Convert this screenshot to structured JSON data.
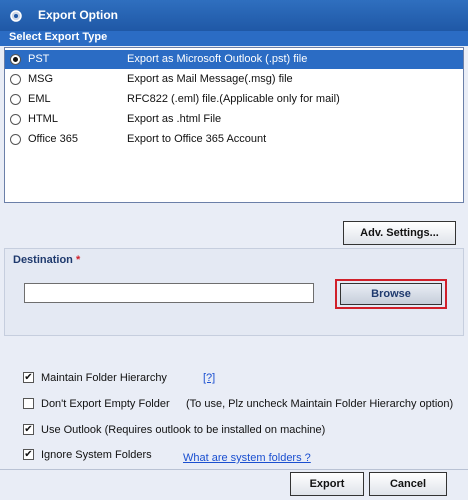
{
  "window": {
    "title": "Export Option",
    "icon": "wrench-gear-icon"
  },
  "export_type": {
    "header": "Select Export Type",
    "options": [
      {
        "name": "PST",
        "description": "Export as Microsoft Outlook (.pst) file",
        "selected": true
      },
      {
        "name": "MSG",
        "description": "Export as Mail Message(.msg) file",
        "selected": false
      },
      {
        "name": "EML",
        "description": "RFC822 (.eml) file.(Applicable only for mail)",
        "selected": false
      },
      {
        "name": "HTML",
        "description": "Export as .html File",
        "selected": false
      },
      {
        "name": "Office 365",
        "description": "Export to Office 365 Account",
        "selected": false
      }
    ]
  },
  "adv_settings_label": "Adv. Settings...",
  "destination": {
    "label": "Destination",
    "required_mark": "*",
    "value": "",
    "browse_label": "Browse"
  },
  "options": {
    "maintain_hierarchy": {
      "label": "Maintain Folder Hierarchy",
      "checked": true,
      "help_link": "[?]"
    },
    "dont_export_empty": {
      "label": "Don't Export Empty Folder",
      "checked": false,
      "note": "(To use, Plz uncheck Maintain Folder Hierarchy option)"
    },
    "use_outlook": {
      "label": "Use Outlook (Requires outlook to be installed on machine)",
      "checked": true
    },
    "ignore_system": {
      "label": "Ignore System Folders",
      "checked": true,
      "help_link": "What are system folders ?"
    }
  },
  "footer": {
    "export_label": "Export",
    "cancel_label": "Cancel"
  },
  "colors": {
    "title_bar": "#1f58a6",
    "selection": "#2b6cc4",
    "highlight_border": "#d0202a"
  }
}
